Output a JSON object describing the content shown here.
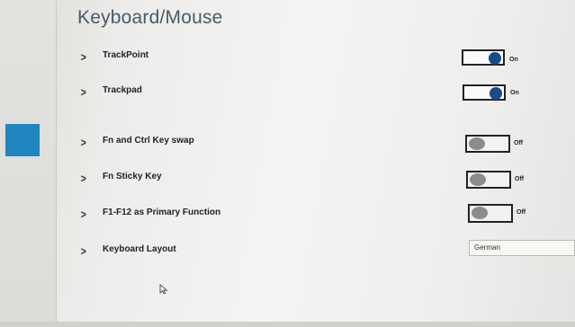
{
  "page": {
    "title": "Keyboard/Mouse"
  },
  "settings": [
    {
      "label": "TrackPoint",
      "type": "toggle",
      "state": "On",
      "value": true
    },
    {
      "label": "Trackpad",
      "type": "toggle",
      "state": "On",
      "value": true
    },
    {
      "label": "Fn and Ctrl Key swap",
      "type": "toggle",
      "state": "Off",
      "value": false
    },
    {
      "label": "Fn Sticky Key",
      "type": "toggle",
      "state": "Off",
      "value": false
    },
    {
      "label": "F1-F12 as Primary Function",
      "type": "toggle",
      "state": "Off",
      "value": false
    },
    {
      "label": "Keyboard Layout",
      "type": "select",
      "selected": "German"
    }
  ],
  "icons": {
    "expand": "chevron-right-icon",
    "cursor": "mouse-pointer-icon"
  },
  "colors": {
    "accent_nav": "#1f86bf",
    "toggle_on_knob": "#1a4a8a",
    "toggle_off_knob": "#8c8c8c"
  }
}
